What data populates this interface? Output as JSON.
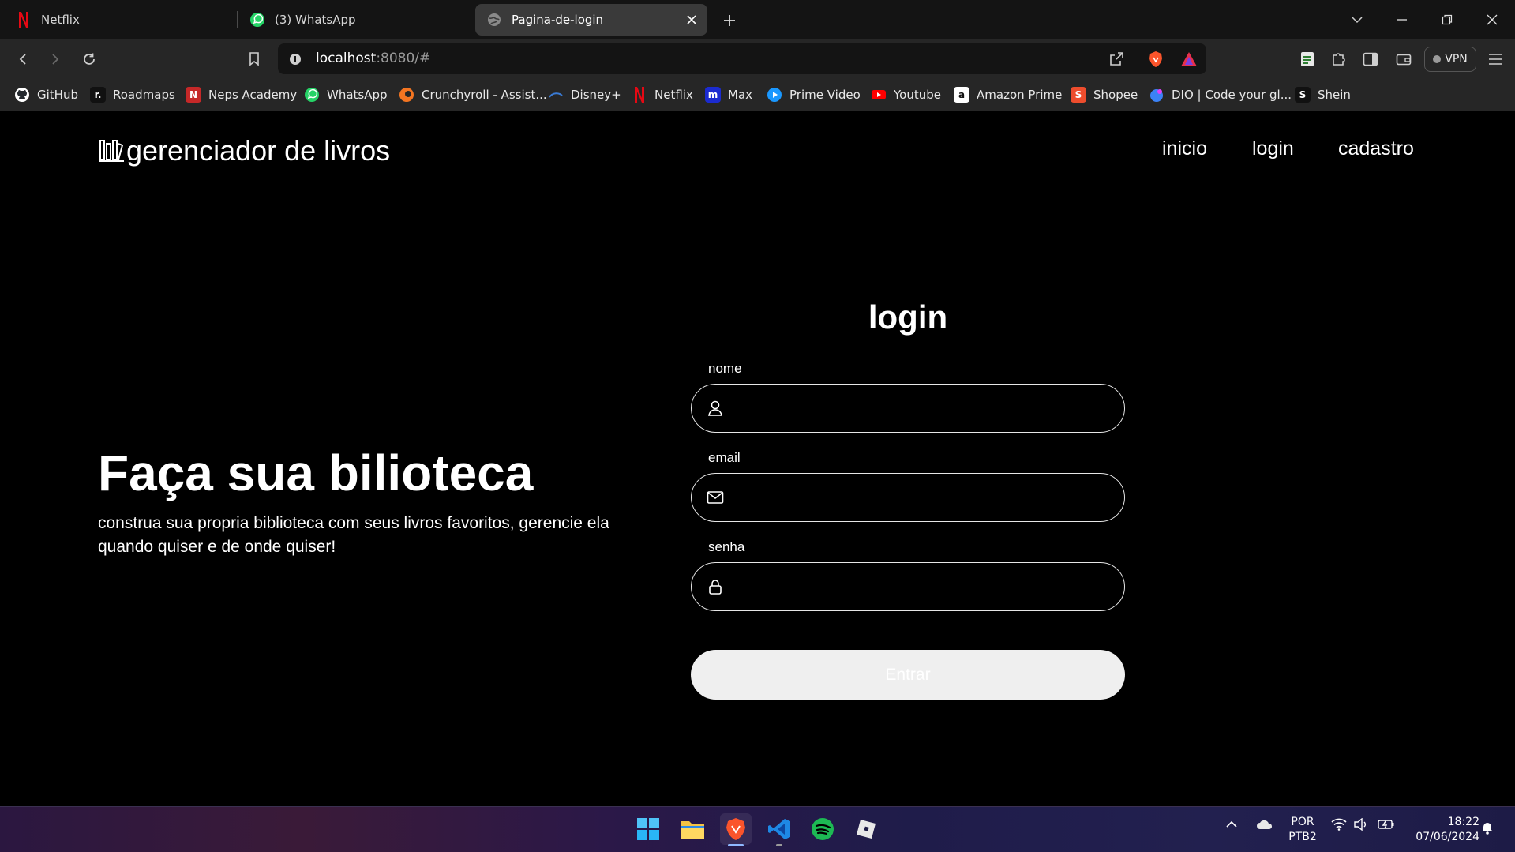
{
  "browser": {
    "tabs": [
      {
        "title": "Netflix",
        "icon": "netflix-icon"
      },
      {
        "title": "(3) WhatsApp",
        "icon": "whatsapp-icon"
      },
      {
        "title": "Pagina-de-login",
        "icon": "globe-icon",
        "active": true
      }
    ],
    "url_host": "localhost",
    "url_rest": ":8080/#",
    "vpn_label": "VPN",
    "bookmarks": [
      {
        "label": "GitHub",
        "color": "#24292e"
      },
      {
        "label": "Roadmaps",
        "color": "#111111"
      },
      {
        "label": "Neps Academy",
        "color": "#c62828"
      },
      {
        "label": "WhatsApp",
        "color": "#25d366"
      },
      {
        "label": "Crunchyroll - Assist...",
        "color": "#f47521"
      },
      {
        "label": "Disney+",
        "color": "#1a3a8a"
      },
      {
        "label": "Netflix",
        "color": "#e50914"
      },
      {
        "label": "Max",
        "color": "#1b2bd0"
      },
      {
        "label": "Prime Video",
        "color": "#1a98ff"
      },
      {
        "label": "Youtube",
        "color": "#ff0000"
      },
      {
        "label": "Amazon Prime",
        "color": "#ffffff"
      },
      {
        "label": "Shopee",
        "color": "#ee4d2d"
      },
      {
        "label": "DIO | Code your gl...",
        "color": "#3b82f6"
      },
      {
        "label": "Shein",
        "color": "#111111"
      }
    ]
  },
  "site": {
    "brand": "gerenciador de livros",
    "nav": [
      "inicio",
      "login",
      "cadastro"
    ],
    "hero_title": "Faça sua bilioteca",
    "hero_text": "construa sua propria biblioteca com seus livros favoritos, gerencie ela quando quiser e de onde quiser!",
    "form": {
      "title": "login",
      "fields": [
        {
          "label": "nome",
          "icon": "user-icon",
          "value": ""
        },
        {
          "label": "email",
          "icon": "mail-icon",
          "value": ""
        },
        {
          "label": "senha",
          "icon": "lock-icon",
          "value": ""
        }
      ],
      "submit_label": "Entrar"
    }
  },
  "taskbar": {
    "language": "POR",
    "keyboard": "PTB2",
    "time": "18:22",
    "date": "07/06/2024"
  }
}
